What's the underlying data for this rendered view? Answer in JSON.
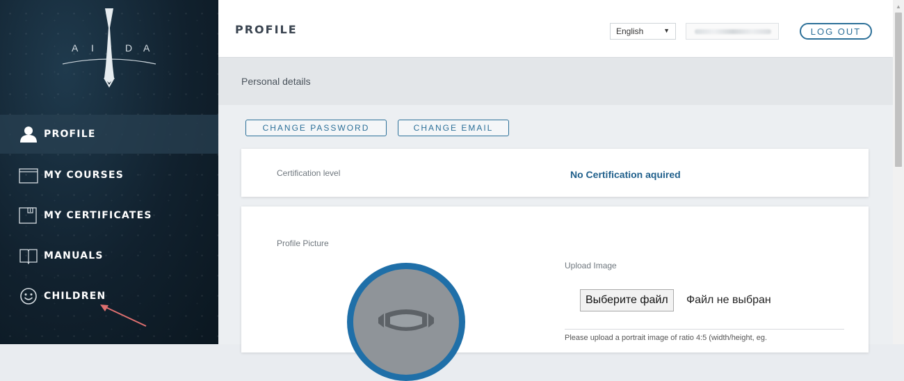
{
  "logo": {
    "letters": [
      "A",
      "I",
      "D",
      "A"
    ]
  },
  "sidebar": {
    "items": [
      {
        "label": "PROFILE",
        "icon": "user-icon",
        "active": true
      },
      {
        "label": "MY COURSES",
        "icon": "folder-icon",
        "active": false
      },
      {
        "label": "MY CERTIFICATES",
        "icon": "certificate-icon",
        "active": false
      },
      {
        "label": "MANUALS",
        "icon": "book-icon",
        "active": false
      },
      {
        "label": "CHILDREN",
        "icon": "smiley-icon",
        "active": false
      }
    ]
  },
  "header": {
    "title": "PROFILE",
    "language": "English",
    "logout_label": "LOG OUT"
  },
  "section": {
    "title": "Personal details"
  },
  "actions": {
    "change_password": "CHANGE PASSWORD",
    "change_email": "CHANGE EMAIL"
  },
  "certification": {
    "label": "Certification level",
    "value": "No Certification aquired"
  },
  "profile_picture": {
    "label": "Profile Picture",
    "upload_label": "Upload Image",
    "file_button": "Выберите файл",
    "file_status": "Файл не выбран",
    "hint": "Please upload a portrait image of ratio 4:5 (width/height, eg."
  },
  "colors": {
    "accent": "#2b6f98",
    "sidebar_bg": "#11212e",
    "avatar_ring": "#1f6fa8",
    "annotation_arrow": "#e07070"
  }
}
